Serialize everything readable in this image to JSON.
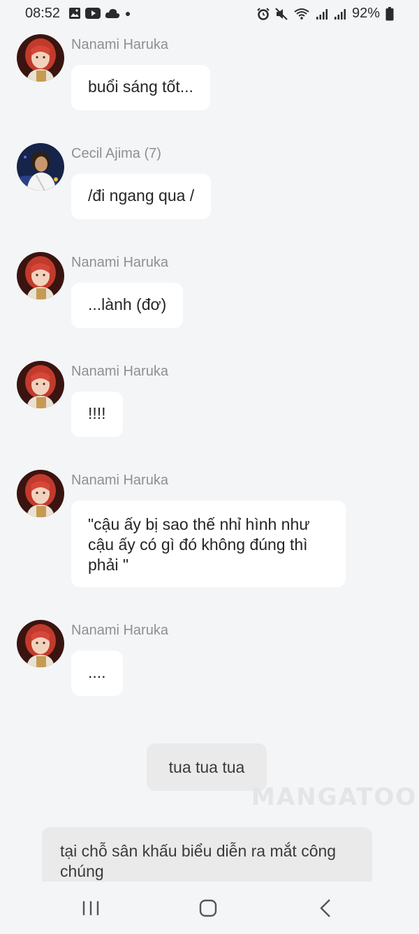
{
  "status_bar": {
    "time": "08:52",
    "battery": "92%",
    "left_icons": [
      "gallery-icon",
      "youtube-icon",
      "cloud-icon",
      "dot-icon"
    ],
    "right_icons": [
      "alarm-icon",
      "mute-icon",
      "wifi-icon",
      "signal-icon",
      "signal-icon",
      "battery-icon"
    ]
  },
  "messages": [
    {
      "name": "Nanami Haruka",
      "text": "buổi sáng tốt..."
    },
    {
      "name": "Cecil Ajima (7)",
      "text": "/đi ngang qua /"
    },
    {
      "name": "Nanami Haruka",
      "text": "...lành (đơ)"
    },
    {
      "name": "Nanami Haruka",
      "text": "!!!!"
    },
    {
      "name": "Nanami Haruka",
      "text": "\"cậu ấy bị sao thế nhỉ hình như cậu ấy có gì đó không đúng thì phải \""
    },
    {
      "name": "Nanami Haruka",
      "text": "...."
    }
  ],
  "narrations": [
    {
      "text": "tua tua tua"
    },
    {
      "text": "tại chỗ sân khấu biểu diễn ra mắt công chúng"
    }
  ],
  "watermark": "MANGATOON",
  "colors": {
    "background": "#f4f5f7",
    "bubble": "#ffffff",
    "narration": "#eaeaea",
    "name": "#8d8f94"
  }
}
